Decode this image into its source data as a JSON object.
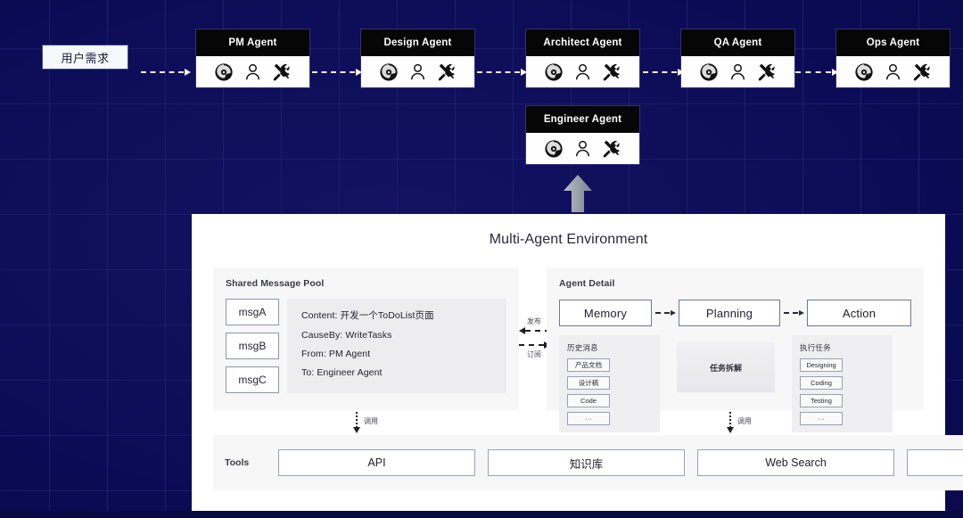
{
  "background": {
    "color": "#0b0b55",
    "grid_color": "#7a8ce6"
  },
  "flow": {
    "user_request_label": "用户需求",
    "agents": [
      {
        "name": "PM Agent",
        "icons": [
          "brain-icon",
          "person-icon",
          "tools-icon"
        ]
      },
      {
        "name": "Design Agent",
        "icons": [
          "brain-icon",
          "person-icon",
          "tools-icon"
        ]
      },
      {
        "name": "Architect Agent",
        "icons": [
          "brain-icon",
          "person-icon",
          "tools-icon"
        ]
      },
      {
        "name": "QA Agent",
        "icons": [
          "brain-icon",
          "person-icon",
          "tools-icon"
        ]
      },
      {
        "name": "Ops Agent",
        "icons": [
          "brain-icon",
          "person-icon",
          "tools-icon"
        ]
      }
    ],
    "engineer_agent": {
      "name": "Engineer Agent",
      "icons": [
        "brain-icon",
        "person-icon",
        "tools-icon"
      ]
    }
  },
  "panel": {
    "title": "Multi-Agent Environment",
    "shared_message_pool": {
      "label": "Shared Message Pool",
      "messages": [
        "msgA",
        "msgB",
        "msgC"
      ],
      "detail": [
        "Content: 开发一个ToDoList页面",
        "CauseBy: WriteTasks",
        "From:  PM Agent",
        "To:  Engineer Agent"
      ]
    },
    "pubsub": {
      "publish_label": "发布",
      "subscribe_label": "订阅"
    },
    "agent_detail": {
      "label": "Agent Detail",
      "stages": [
        "Memory",
        "Planning",
        "Action"
      ],
      "memory_card": {
        "title": "历史消息",
        "chips": [
          "产品文档",
          "设计稿",
          "Code",
          "···"
        ]
      },
      "planning_card": {
        "title": "任务拆解"
      },
      "action_card": {
        "title": "执行任务",
        "chips": [
          "Designing",
          "Coding",
          "Testing",
          "···"
        ]
      }
    },
    "call_label_left": "调用",
    "call_label_right": "调用",
    "tools": {
      "label": "Tools",
      "items": [
        "API",
        "知识库",
        "Web Search",
        "···"
      ]
    }
  }
}
